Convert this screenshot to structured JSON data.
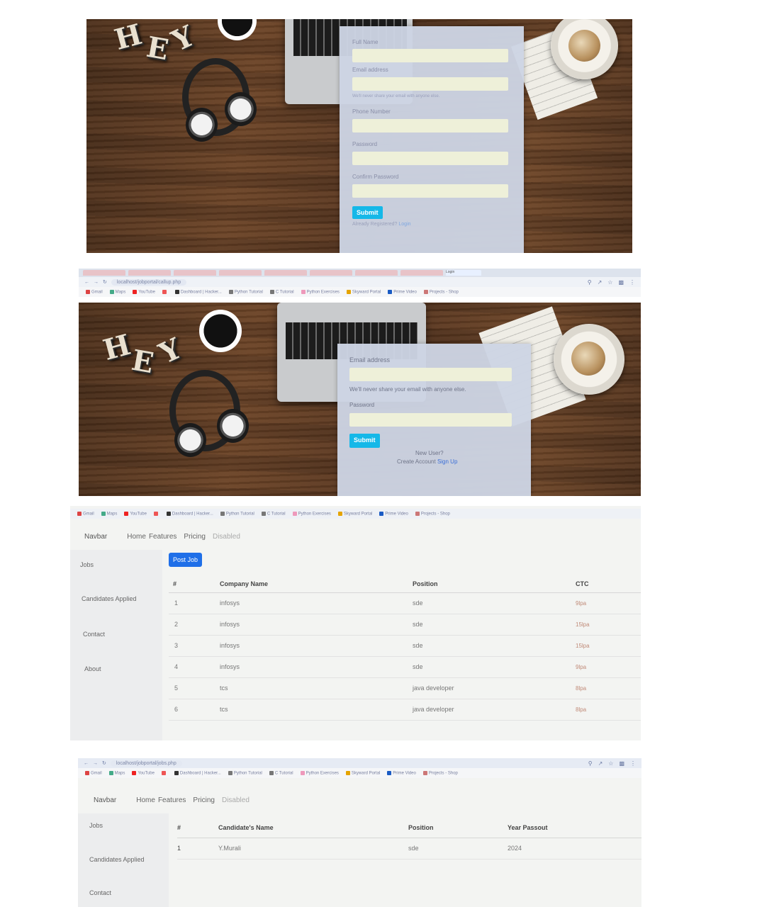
{
  "signup_panel": {
    "fields": [
      {
        "label": "Full Name"
      },
      {
        "label": "Email address"
      },
      {
        "label": "Phone Number"
      },
      {
        "label": "Password"
      },
      {
        "label": "Confirm Password"
      }
    ],
    "email_help": "We'll never share your email with anyone else.",
    "submit_label": "Submit",
    "already_text": "Already Registered?",
    "login_link": "Login"
  },
  "login_panel": {
    "browser": {
      "url": "localhost/jobportal/callup.php",
      "tabs": [
        "",
        "",
        "",
        "",
        "",
        "",
        "",
        "",
        "Login"
      ],
      "bookmarks": [
        "Gmail",
        "Maps",
        "YouTube",
        "",
        "Dashboard | Hacker...",
        "Python Tutorial",
        "C Tutorial",
        "Python Exercises",
        "Skyward Portal",
        "Prime Video",
        "Projects - Shop"
      ]
    },
    "email_label": "Email address",
    "email_help": "We'll never share your email with anyone else.",
    "password_label": "Password",
    "submit_label": "Submit",
    "new_user_text": "New User?",
    "create_account_text": "Create Account",
    "signup_link": "Sign Up"
  },
  "jobs_panel": {
    "bookmarks": [
      "Gmail",
      "Maps",
      "YouTube",
      "",
      "Dashboard | Hacker...",
      "Python Tutorial",
      "C Tutorial",
      "Python Exercises",
      "Skyward Portal",
      "Prime Video",
      "Projects - Shop"
    ],
    "navbar": {
      "brand": "Navbar",
      "links": [
        "Home",
        "Features",
        "Pricing"
      ],
      "disabled": "Disabled"
    },
    "sidebar": [
      "Jobs",
      "Candidates Applied",
      "Contact",
      "About"
    ],
    "post_button": "Post Job",
    "columns": [
      "#",
      "Company Name",
      "Position",
      "CTC"
    ],
    "rows": [
      {
        "num": "1",
        "company": "infosys",
        "position": "sde",
        "ctc": "9lpa"
      },
      {
        "num": "2",
        "company": "infosys",
        "position": "sde",
        "ctc": "15lpa"
      },
      {
        "num": "3",
        "company": "infosys",
        "position": "sde",
        "ctc": "15lpa"
      },
      {
        "num": "4",
        "company": "infosys",
        "position": "sde",
        "ctc": "9lpa"
      },
      {
        "num": "5",
        "company": "tcs",
        "position": "java developer",
        "ctc": "8lpa"
      },
      {
        "num": "6",
        "company": "tcs",
        "position": "java developer",
        "ctc": "8lpa"
      }
    ]
  },
  "candidates_panel": {
    "browser": {
      "url": "localhost/jobportal/jobs.php",
      "bookmarks": [
        "Gmail",
        "Maps",
        "YouTube",
        "",
        "Dashboard | Hacker...",
        "Python Tutorial",
        "C Tutorial",
        "Python Exercises",
        "Skyward Portal",
        "Prime Video",
        "Projects - Shop"
      ]
    },
    "navbar": {
      "brand": "Navbar",
      "links": [
        "Home",
        "Features",
        "Pricing"
      ],
      "disabled": "Disabled"
    },
    "sidebar": [
      "Jobs",
      "Candidates Applied",
      "Contact"
    ],
    "columns": [
      "#",
      "Candidate's Name",
      "Position",
      "Year Passout"
    ],
    "rows": [
      {
        "num": "1",
        "name": "Y.Murali",
        "position": "sde",
        "year": "2024"
      }
    ]
  }
}
